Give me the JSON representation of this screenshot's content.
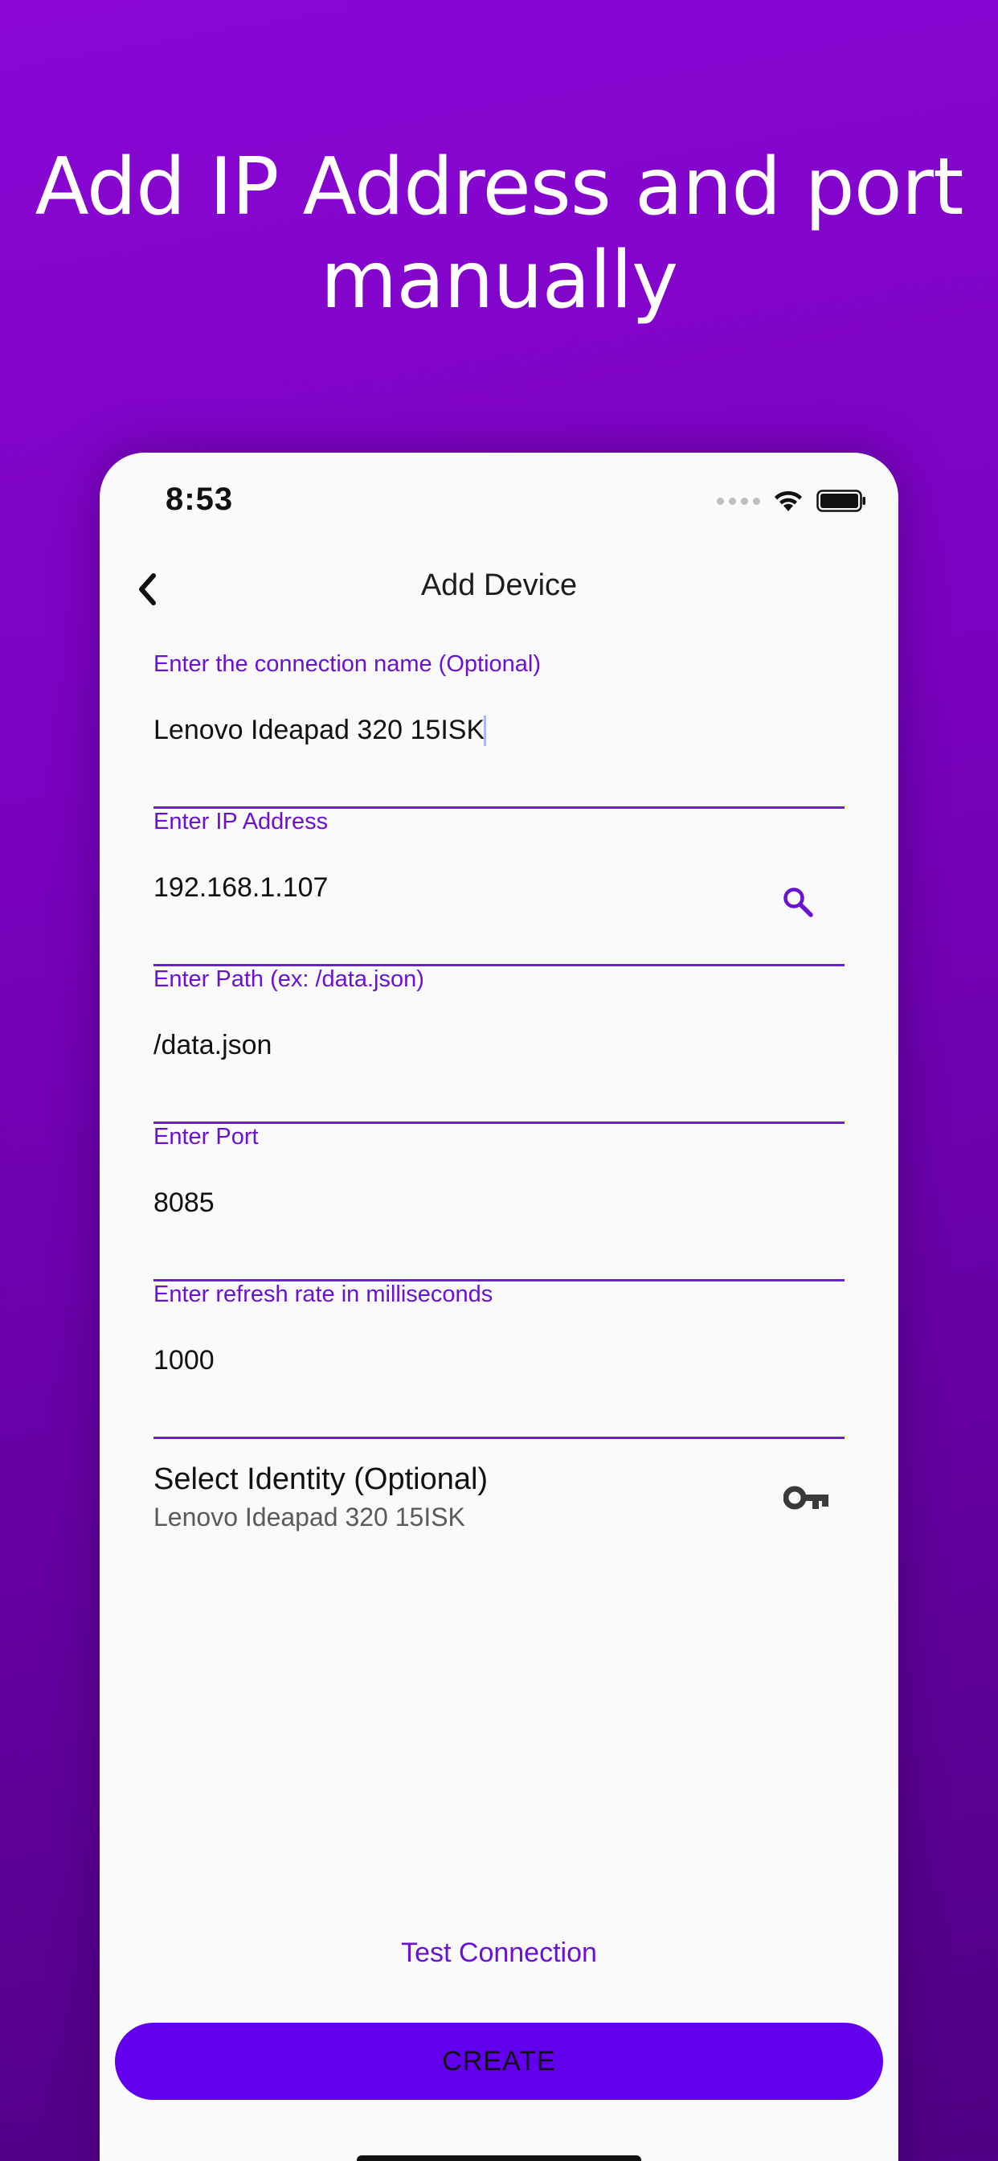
{
  "headline": "Add IP Address and port manually",
  "status_bar": {
    "time": "8:53"
  },
  "nav": {
    "title": "Add Device"
  },
  "fields": [
    {
      "label": "Enter the connection name (Optional)",
      "value": "Lenovo Ideapad 320 15ISK"
    },
    {
      "label": "Enter IP Address",
      "value": "192.168.1.107"
    },
    {
      "label": "Enter Path (ex: /data.json)",
      "value": "/data.json"
    },
    {
      "label": "Enter Port",
      "value": "8085"
    },
    {
      "label": "Enter refresh rate in milliseconds",
      "value": "1000"
    }
  ],
  "identity": {
    "title": "Select Identity (Optional)",
    "subtitle": "Lenovo Ideapad 320 15ISK"
  },
  "actions": {
    "test_label": "Test Connection",
    "create_label": "CREATE"
  },
  "icons": {
    "back": "chevron-left-icon",
    "search": "search-icon",
    "key": "key-icon",
    "wifi": "wifi-icon",
    "battery": "battery-icon"
  },
  "colors": {
    "accent": "#6200ee",
    "label": "#6a12d4",
    "background_top": "#8a07d6",
    "background_bottom": "#4f0084"
  }
}
